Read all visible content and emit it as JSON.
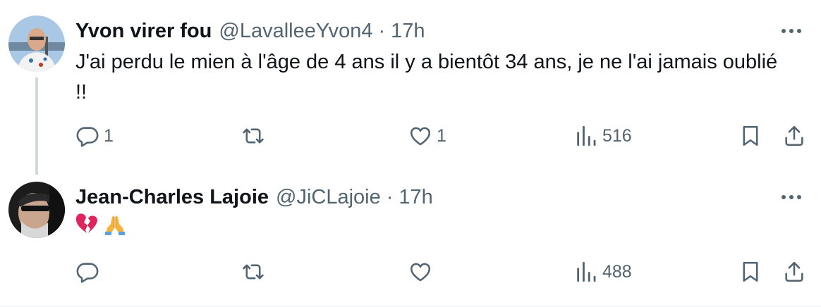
{
  "tweets": [
    {
      "author_name": "Yvon virer fou",
      "handle": "@LavalleeYvon4",
      "separator": "·",
      "time": "17h",
      "text": "J'ai perdu le mien à l'âge de 4 ans il y a bientôt 34 ans, je ne l'ai jamais oublié !!",
      "reply_count": "1",
      "retweet_count": "",
      "like_count": "1",
      "view_count": "516"
    },
    {
      "author_name": "Jean-Charles Lajoie",
      "handle": "@JiCLajoie",
      "separator": "·",
      "time": "17h",
      "emojis": [
        "broken-heart-emoji",
        "folded-hands-emoji"
      ],
      "reply_count": "",
      "retweet_count": "",
      "like_count": "",
      "view_count": "488"
    }
  ],
  "colors": {
    "text_primary": "#0f1419",
    "text_secondary": "#536471",
    "thread_line": "#cfd9de",
    "broken_heart": "#e0245e",
    "folded_hands": "#f7b23b"
  }
}
